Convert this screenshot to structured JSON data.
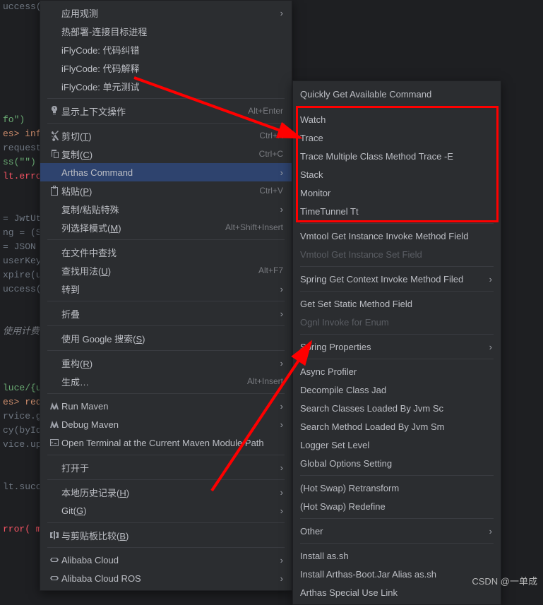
{
  "code_fragments": [
    {
      "t": "uccess(",
      "cls": ""
    },
    {
      "t": "",
      "cls": ""
    },
    {
      "t": "",
      "cls": ""
    },
    {
      "t": "",
      "cls": ""
    },
    {
      "t": "",
      "cls": ""
    },
    {
      "t": "",
      "cls": ""
    },
    {
      "t": "",
      "cls": ""
    },
    {
      "t": "",
      "cls": ""
    },
    {
      "t": "fo\")",
      "cls": "str"
    },
    {
      "t": "es> inf",
      "cls": "kw"
    },
    {
      "t": "request",
      "cls": ""
    },
    {
      "t": "ss(\"\") ",
      "cls": "str"
    },
    {
      "t": "lt.erro",
      "cls": "err"
    },
    {
      "t": "",
      "cls": ""
    },
    {
      "t": "",
      "cls": ""
    },
    {
      "t": "= JwtUt",
      "cls": ""
    },
    {
      "t": "ng = (S",
      "cls": ""
    },
    {
      "t": "= JSON",
      "cls": ""
    },
    {
      "t": "userKey",
      "cls": ""
    },
    {
      "t": "xpire(u",
      "cls": ""
    },
    {
      "t": "uccess(",
      "cls": ""
    },
    {
      "t": "",
      "cls": ""
    },
    {
      "t": "",
      "cls": ""
    },
    {
      "t": "使用计费",
      "cls": "cmt"
    },
    {
      "t": "",
      "cls": ""
    },
    {
      "t": "",
      "cls": ""
    },
    {
      "t": "",
      "cls": ""
    },
    {
      "t": "luce/{u",
      "cls": "str"
    },
    {
      "t": "es> red",
      "cls": "kw"
    },
    {
      "t": "rvice.g",
      "cls": ""
    },
    {
      "t": "cy(byId",
      "cls": ""
    },
    {
      "t": "vice.up",
      "cls": ""
    },
    {
      "t": "",
      "cls": ""
    },
    {
      "t": "",
      "cls": ""
    },
    {
      "t": "lt.succ",
      "cls": ""
    },
    {
      "t": "",
      "cls": ""
    },
    {
      "t": "",
      "cls": ""
    },
    {
      "t": "rror( m",
      "cls": "err"
    }
  ],
  "menu1": {
    "groups": [
      {
        "items": [
          {
            "label": "应用观测",
            "sub": true
          },
          {
            "label": "热部署-连接目标进程"
          },
          {
            "label": "iFlyCode: 代码纠错"
          },
          {
            "label": "iFlyCode: 代码解释"
          },
          {
            "label": "iFlyCode: 单元测试"
          }
        ]
      },
      {
        "items": [
          {
            "icon": "bulb",
            "label": "显示上下文操作",
            "shortcut": "Alt+Enter"
          }
        ]
      },
      {
        "items": [
          {
            "icon": "scissors",
            "label": "剪切(",
            "u": "T",
            "after": ")",
            "shortcut": "Ctrl+X"
          },
          {
            "icon": "copy",
            "label": "复制(",
            "u": "C",
            "after": ")",
            "shortcut": "Ctrl+C"
          },
          {
            "label": "Arthas Command",
            "sub": true,
            "selected": true
          },
          {
            "icon": "paste",
            "label": "粘贴(",
            "u": "P",
            "after": ")",
            "shortcut": "Ctrl+V"
          },
          {
            "label": "复制/粘贴特殊",
            "sub": true
          },
          {
            "label": "列选择模式(",
            "u": "M",
            "after": ")",
            "shortcut": "Alt+Shift+Insert"
          }
        ]
      },
      {
        "items": [
          {
            "label": "在文件中查找"
          },
          {
            "label": "查找用法(",
            "u": "U",
            "after": ")",
            "shortcut": "Alt+F7"
          },
          {
            "label": "转到",
            "sub": true
          }
        ]
      },
      {
        "items": [
          {
            "label": "折叠",
            "sub": true
          }
        ]
      },
      {
        "items": [
          {
            "label": "使用 Google 搜索(",
            "u": "S",
            "after": ")"
          }
        ]
      },
      {
        "items": [
          {
            "label": "重构(",
            "u": "R",
            "after": ")",
            "sub": true
          },
          {
            "label": "生成…",
            "shortcut": "Alt+Insert"
          }
        ]
      },
      {
        "items": [
          {
            "icon": "maven",
            "label": "Run Maven",
            "sub": true
          },
          {
            "icon": "maven",
            "label": "Debug Maven",
            "sub": true
          },
          {
            "icon": "terminal",
            "label": "Open Terminal at the Current Maven Module Path"
          }
        ]
      },
      {
        "items": [
          {
            "label": "打开于",
            "sub": true
          }
        ]
      },
      {
        "items": [
          {
            "label": "本地历史记录(",
            "u": "H",
            "after": ")",
            "sub": true
          },
          {
            "label": "Git(",
            "u": "G",
            "after": ")",
            "sub": true
          }
        ]
      },
      {
        "items": [
          {
            "icon": "compare",
            "label": "与剪贴板比较(",
            "u": "B",
            "after": ")"
          }
        ]
      },
      {
        "items": [
          {
            "icon": "ali",
            "label": "Alibaba Cloud",
            "sub": true
          },
          {
            "icon": "ali",
            "label": "Alibaba Cloud ROS",
            "sub": true
          }
        ]
      }
    ]
  },
  "menu2": {
    "header": "Quickly Get Available Command",
    "groups": [
      {
        "boxed": true,
        "items": [
          {
            "label": "Watch"
          },
          {
            "label": "Trace"
          },
          {
            "label": "Trace Multiple Class Method Trace -E"
          },
          {
            "label": "Stack"
          },
          {
            "label": "Monitor"
          },
          {
            "label": "TimeTunnel Tt"
          }
        ]
      },
      {
        "items": [
          {
            "label": "Vmtool Get Instance Invoke Method Field"
          },
          {
            "label": "Vmtool Get Instance Set Field",
            "disabled": true
          }
        ]
      },
      {
        "items": [
          {
            "label": "Spring Get Context Invoke Method Filed",
            "sub": true
          }
        ]
      },
      {
        "items": [
          {
            "label": "Get Set Static Method Field"
          },
          {
            "label": "Ognl Invoke for Enum",
            "disabled": true
          }
        ]
      },
      {
        "items": [
          {
            "label": "Spring Properties",
            "sub": true
          }
        ]
      },
      {
        "items": [
          {
            "label": "Async Profiler"
          },
          {
            "label": "Decompile Class Jad"
          },
          {
            "label": "Search Classes Loaded By Jvm Sc"
          },
          {
            "label": "Search Method Loaded By Jvm Sm"
          },
          {
            "label": "Logger Set Level"
          },
          {
            "label": "Global Options Setting"
          }
        ]
      },
      {
        "items": [
          {
            "label": "(Hot Swap) Retransform"
          },
          {
            "label": "(Hot Swap) Redefine"
          }
        ]
      },
      {
        "items": [
          {
            "label": "Other",
            "sub": true
          }
        ]
      },
      {
        "items": [
          {
            "label": "Install as.sh"
          },
          {
            "label": "Install Arthas-Boot.Jar Alias as.sh"
          },
          {
            "label": "Arthas Special Use Link"
          }
        ]
      }
    ]
  },
  "watermark": "CSDN @一单成"
}
